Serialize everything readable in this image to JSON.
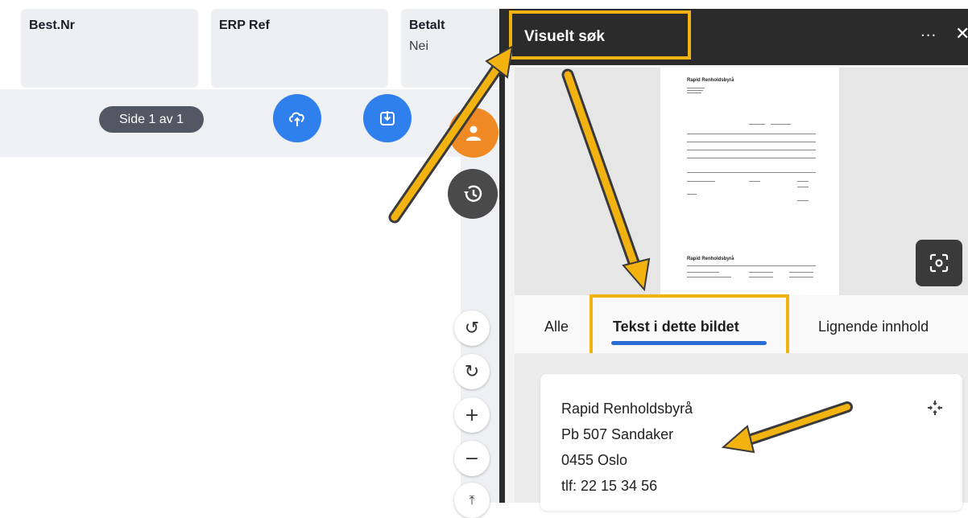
{
  "fields": [
    {
      "label": "Best.Nr",
      "value": ""
    },
    {
      "label": "ERP Ref",
      "value": ""
    },
    {
      "label": "Betalt",
      "value": "Nei"
    }
  ],
  "pagination": {
    "text": "Side 1 av 1"
  },
  "zoom_controls": {
    "rotate_left": "↺",
    "rotate_right": "↻",
    "zoom_in": "+",
    "zoom_out": "−",
    "fit": "⤒"
  },
  "panel": {
    "title": "Visuelt søk",
    "more": "···",
    "close": "✕",
    "preview": {
      "doc_header": "Rapid Renholdsbyrå",
      "doc_footer": "Rapid Renholdsbyrå"
    },
    "tabs": [
      {
        "label": "Alle",
        "active": false
      },
      {
        "label": "Tekst i dette bildet",
        "active": true
      },
      {
        "label": "Lignende innhold",
        "active": false
      }
    ],
    "result_lines": [
      "Rapid Renholdsbyrå",
      "Pb 507 Sandaker",
      "0455 Oslo",
      "tlf: 22 15 34 56"
    ]
  },
  "colors": {
    "highlight": "#f2b20f",
    "accent_blue": "#2f80ed",
    "tab_underline": "#2a6cd6",
    "orange": "#f08a24",
    "dark_panel": "#2b2b2b"
  },
  "icons": [
    "cloud-upload-icon",
    "download-icon",
    "user-icon",
    "history-icon",
    "scan-icon",
    "expand-icon",
    "rotate-left-icon",
    "rotate-right-icon",
    "plus-icon",
    "minus-icon",
    "fit-top-icon"
  ]
}
